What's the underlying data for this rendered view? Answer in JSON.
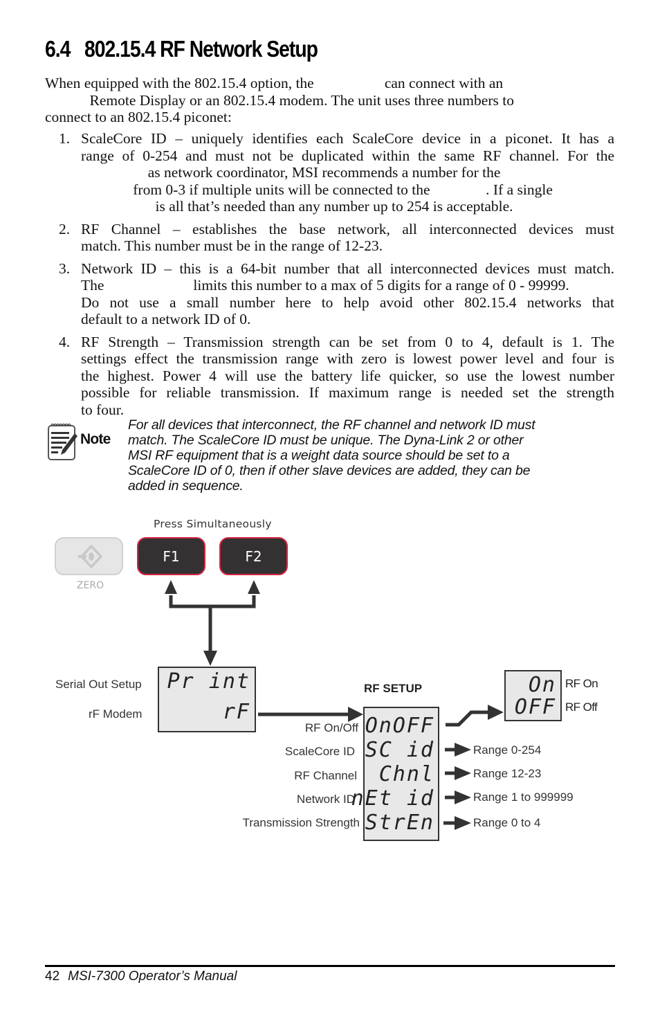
{
  "section": {
    "number": "6.4",
    "title": "802.15.4 RF Network Setup"
  },
  "intro": {
    "lines": [
      "When equipped with the 802.15.4 option, the                   can connect with an",
      "            Remote Display or an 802.15.4 modem. The unit uses three numbers to",
      "connect to an 802.15.4 piconet:"
    ]
  },
  "items": [
    {
      "num": "1.",
      "lines": [
        "ScaleCore ID – uniquely identifies each ScaleCore device in a piconet. It has a",
        "range of 0-254 and must not be duplicated within the same RF channel. For the",
        "                  as network coordinator, MSI recommends a number for the",
        "              from 0-3 if multiple units will be connected to the               . If a single",
        "                    is all that’s needed than any number up to 254 is acceptable."
      ]
    },
    {
      "num": "2.",
      "lines": [
        "RF Channel – establishes the base network, all interconnected devices must",
        "match. This number must be in the range of 12-23."
      ]
    },
    {
      "num": "3.",
      "lines": [
        "Network ID – this is a 64-bit number that all interconnected devices must match.",
        "The                        limits this number to a max of 5 digits for a range of 0 - 99999.",
        "Do not use a small number here to help avoid other 802.15.4 networks that",
        "default to a network ID of 0."
      ]
    },
    {
      "num": "4.",
      "lines": [
        "RF Strength – Transmission strength can be set from 0 to 4, default is 1. The",
        "settings effect the transmission range with zero is lowest power level and four is",
        "the highest. Power 4 will use the battery life quicker, so use the lowest number",
        "possible for reliable transmission. If maximum range is needed set the strength",
        "to four."
      ]
    }
  ],
  "note": {
    "icon": "note-pad-pencil-icon",
    "label": "Note",
    "lines": [
      "For all devices that interconnect, the RF channel and network ID must",
      "match. The ScaleCore ID must be unique. The Dyna-Link 2 or other",
      "MSI RF equipment that is a weight data source should be set to a",
      "ScaleCore ID of 0, then if other slave devices are added, they can be",
      "added in sequence."
    ]
  },
  "diagram": {
    "press_label": "Press Simultaneously",
    "keys": {
      "zero_caption": "ZERO",
      "zero_icon": "zero-arrow-diamond-icon",
      "f1": "F1",
      "f2": "F2"
    },
    "colors": {
      "key_fill": "#333132",
      "key_border": "#d4243f",
      "lcd_fill": "#e8e8e8",
      "zero_fill": "#e6e6e6"
    },
    "main_display": {
      "labels": [
        "Serial Out Setup",
        "rF Modem"
      ],
      "segments": [
        "Pr int",
        "rF"
      ]
    },
    "rf_setup": {
      "title": "RF SETUP",
      "rows": [
        {
          "label": "RF On/Off",
          "segment": "OnOFF"
        },
        {
          "label": "ScaleCore ID",
          "segment": "SC id",
          "range": "Range 0-254"
        },
        {
          "label": "RF Channel",
          "segment": "Chnl",
          "range": "Range 12-23"
        },
        {
          "label": "Network ID",
          "segment": "nEt id",
          "range": "Range 1 to 999999"
        },
        {
          "label": "Transmission Strength",
          "segment": "StrEn",
          "range": "Range 0 to 4"
        }
      ]
    },
    "onoff_display": {
      "segments": [
        "On",
        "OFF"
      ],
      "labels": [
        "RF On",
        "RF Off"
      ]
    }
  },
  "footer": {
    "page": "42",
    "title": "MSI-7300 Operator’s Manual"
  }
}
